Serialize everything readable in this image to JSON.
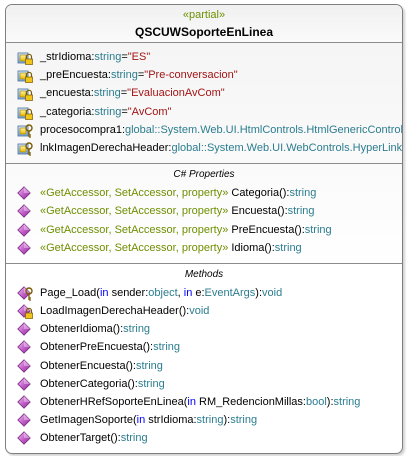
{
  "class": {
    "stereotype": "«partial»",
    "name": "QSCUWSoporteEnLinea"
  },
  "fields": [
    {
      "name": "_strIdioma",
      "sep": ":",
      "type": "string",
      "eq": "=",
      "value": "\"ES\"",
      "icon": "private-field-icon"
    },
    {
      "name": "_preEncuesta",
      "sep": ":",
      "type": "string",
      "eq": "=",
      "value": "\"Pre-conversacion\"",
      "icon": "private-field-icon"
    },
    {
      "name": "_encuesta",
      "sep": ":",
      "type": "string",
      "eq": "=",
      "value": "\"EvaluacionAvCom\"",
      "icon": "private-field-icon"
    },
    {
      "name": "_categoria",
      "sep": ":",
      "type": "string",
      "eq": "=",
      "value": "\"AvCom\"",
      "icon": "private-field-icon"
    },
    {
      "name": "procesocompra1",
      "sep": ":",
      "type": "global::System.Web.UI.HtmlControls.HtmlGenericControl",
      "eq": "",
      "value": "",
      "icon": "protected-field-icon"
    },
    {
      "name": "lnkImagenDerechaHeader",
      "sep": ":",
      "type": "global::System.Web.UI.WebControls.HyperLink",
      "eq": "",
      "value": "",
      "icon": "protected-field-icon"
    }
  ],
  "properties_section": {
    "title": "C# Properties",
    "items": [
      {
        "stereotype": "«GetAccessor, SetAccessor, property»",
        "name": " Categoria()",
        "sep": ":",
        "type": "string"
      },
      {
        "stereotype": "«GetAccessor, SetAccessor, property»",
        "name": " Encuesta()",
        "sep": ":",
        "type": "string"
      },
      {
        "stereotype": "«GetAccessor, SetAccessor, property»",
        "name": " PreEncuesta()",
        "sep": ":",
        "type": "string"
      },
      {
        "stereotype": "«GetAccessor, SetAccessor, property»",
        "name": " Idioma()",
        "sep": ":",
        "type": "string"
      }
    ]
  },
  "methods_section": {
    "title": "Methods",
    "items": [
      {
        "kind": "protected",
        "parts": [
          {
            "t": "Page_Load(",
            "c": "blk"
          },
          {
            "t": "in",
            "c": "kw"
          },
          {
            "t": " sender:",
            "c": "blk"
          },
          {
            "t": "object",
            "c": "type"
          },
          {
            "t": ", ",
            "c": "blk"
          },
          {
            "t": "in",
            "c": "kw"
          },
          {
            "t": " e:",
            "c": "blk"
          },
          {
            "t": "EventArgs",
            "c": "type"
          },
          {
            "t": "):",
            "c": "blk"
          },
          {
            "t": "void",
            "c": "type"
          }
        ]
      },
      {
        "kind": "private",
        "parts": [
          {
            "t": "LoadImagenDerechaHeader():",
            "c": "blk"
          },
          {
            "t": "void",
            "c": "type"
          }
        ]
      },
      {
        "kind": "public",
        "parts": [
          {
            "t": "ObtenerIdioma():",
            "c": "blk"
          },
          {
            "t": "string",
            "c": "type"
          }
        ]
      },
      {
        "kind": "public",
        "parts": [
          {
            "t": "ObtenerPreEncuesta():",
            "c": "blk"
          },
          {
            "t": "string",
            "c": "type"
          }
        ]
      },
      {
        "kind": "public",
        "parts": [
          {
            "t": "ObtenerEncuesta():",
            "c": "blk"
          },
          {
            "t": "string",
            "c": "type"
          }
        ]
      },
      {
        "kind": "public",
        "parts": [
          {
            "t": "ObtenerCategoria():",
            "c": "blk"
          },
          {
            "t": "string",
            "c": "type"
          }
        ]
      },
      {
        "kind": "public",
        "parts": [
          {
            "t": "ObtenerHRefSoporteEnLinea(",
            "c": "blk"
          },
          {
            "t": "in",
            "c": "kw"
          },
          {
            "t": " RM_RedencionMillas:",
            "c": "blk"
          },
          {
            "t": "bool",
            "c": "type"
          },
          {
            "t": "):",
            "c": "blk"
          },
          {
            "t": "string",
            "c": "type"
          }
        ]
      },
      {
        "kind": "public",
        "parts": [
          {
            "t": "GetImagenSoporte(",
            "c": "blk"
          },
          {
            "t": "in",
            "c": "kw"
          },
          {
            "t": " strIdioma:",
            "c": "blk"
          },
          {
            "t": "string",
            "c": "type"
          },
          {
            "t": "):",
            "c": "blk"
          },
          {
            "t": "string",
            "c": "type"
          }
        ]
      },
      {
        "kind": "public",
        "parts": [
          {
            "t": "ObtenerTarget():",
            "c": "blk"
          },
          {
            "t": "string",
            "c": "type"
          }
        ]
      }
    ]
  },
  "colors": {
    "stereotype": "#6e8f00",
    "keyword": "#0000ff",
    "type": "#2b7d8f",
    "string_literal": "#a31515",
    "method_icon": "#c05cc7",
    "field_icon": "#e6b800"
  }
}
